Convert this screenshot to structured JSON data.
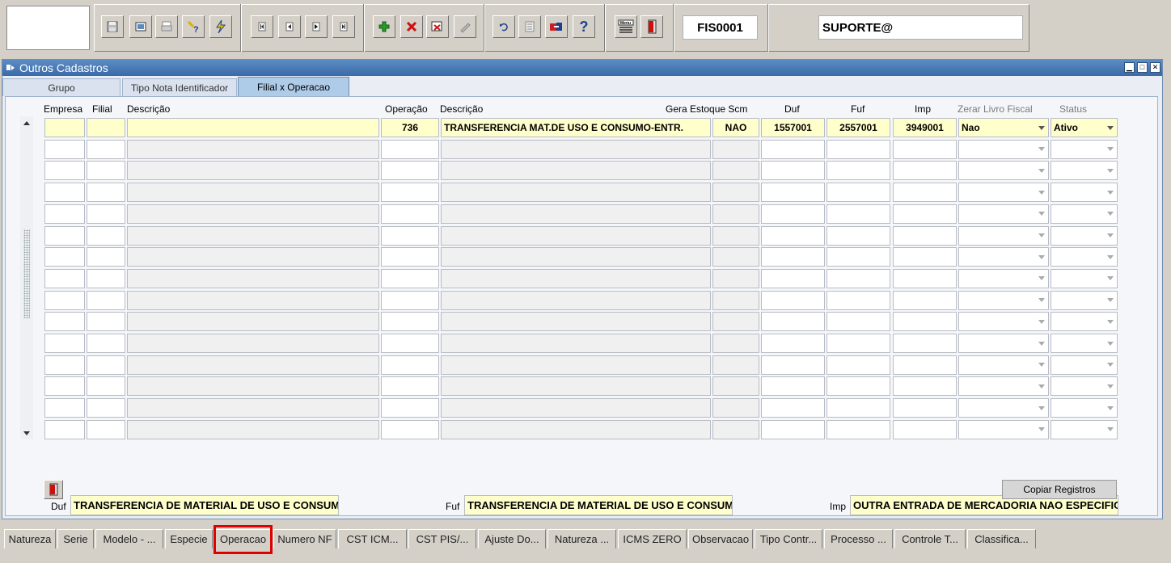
{
  "toolbar": {
    "form_code": "FIS0001",
    "user": "SUPORTE@",
    "buttons": [
      {
        "name": "save-icon",
        "glyph": "💾"
      },
      {
        "name": "window-icon",
        "glyph": "▣"
      },
      {
        "name": "print-icon",
        "glyph": "⎙"
      },
      {
        "name": "query-icon",
        "glyph": "?"
      },
      {
        "name": "execute-query-icon",
        "glyph": "⚡"
      },
      {
        "name": "first-record-icon",
        "glyph": "⏮"
      },
      {
        "name": "prev-record-icon",
        "glyph": "◀"
      },
      {
        "name": "next-record-icon",
        "glyph": "▶"
      },
      {
        "name": "last-record-icon",
        "glyph": "⏭"
      },
      {
        "name": "insert-record-icon",
        "glyph": "✚"
      },
      {
        "name": "delete-record-icon",
        "glyph": "✖"
      },
      {
        "name": "duplicate-record-icon",
        "glyph": "⎘"
      },
      {
        "name": "edit-icon",
        "glyph": "✎"
      },
      {
        "name": "undo-icon",
        "glyph": "↶"
      },
      {
        "name": "list-icon",
        "glyph": "☰"
      },
      {
        "name": "tools-icon",
        "glyph": "⚙"
      },
      {
        "name": "help-icon",
        "glyph": "?"
      },
      {
        "name": "menu-icon",
        "glyph": "☷"
      },
      {
        "name": "exit-icon",
        "glyph": "🚪"
      }
    ]
  },
  "window": {
    "title": "Outros Cadastros",
    "tabs": [
      "Grupo",
      "Tipo Nota Identificador",
      "Filial x Operacao"
    ],
    "active_tab": "Filial x Operacao"
  },
  "grid": {
    "headers": {
      "empresa": "Empresa",
      "filial": "Filial",
      "descricao1": "Descrição",
      "operacao": "Operação",
      "descricao2": "Descrição",
      "gera_estoque": "Gera Estoque Scm",
      "duf": "Duf",
      "fuf": "Fuf",
      "imp": "Imp",
      "zerar": "Zerar Livro Fiscal",
      "status": "Status"
    },
    "rows": [
      {
        "empresa": "",
        "filial": "",
        "descricao1": "",
        "operacao": "736",
        "descricao2": "TRANSFERENCIA MAT.DE USO E CONSUMO-ENTR.",
        "gera_estoque": "NAO",
        "duf": "1557001",
        "fuf": "2557001",
        "imp": "3949001",
        "zerar": "Nao",
        "status": "Ativo"
      }
    ],
    "empty_rows": 14
  },
  "footer": {
    "duf_label": "Duf",
    "duf_value": "TRANSFERENCIA DE MATERIAL DE USO E CONSUMO",
    "fuf_label": "Fuf",
    "fuf_value": "TRANSFERENCIA DE MATERIAL DE USO E CONSUMO",
    "imp_label": "Imp",
    "imp_value": "OUTRA ENTRADA DE MERCADORIA NAO ESPECIFICA",
    "copy_button": "Copiar Registros"
  },
  "bottom_tabs": {
    "items": [
      "Natureza",
      "Serie",
      "Modelo - ...",
      "Especie",
      "Operacao",
      "Numero NF",
      "CST ICM...",
      "CST PIS/...",
      "Ajuste Do...",
      "Natureza ...",
      "ICMS ZERO",
      "Observacao",
      "Tipo Contr...",
      "Processo ...",
      "Controle T...",
      "Classifica..."
    ],
    "active": "Operacao"
  },
  "colors": {
    "title_bar": "#3a6aa8",
    "highlight": "#e00000",
    "current_row": "#ffffcc"
  }
}
